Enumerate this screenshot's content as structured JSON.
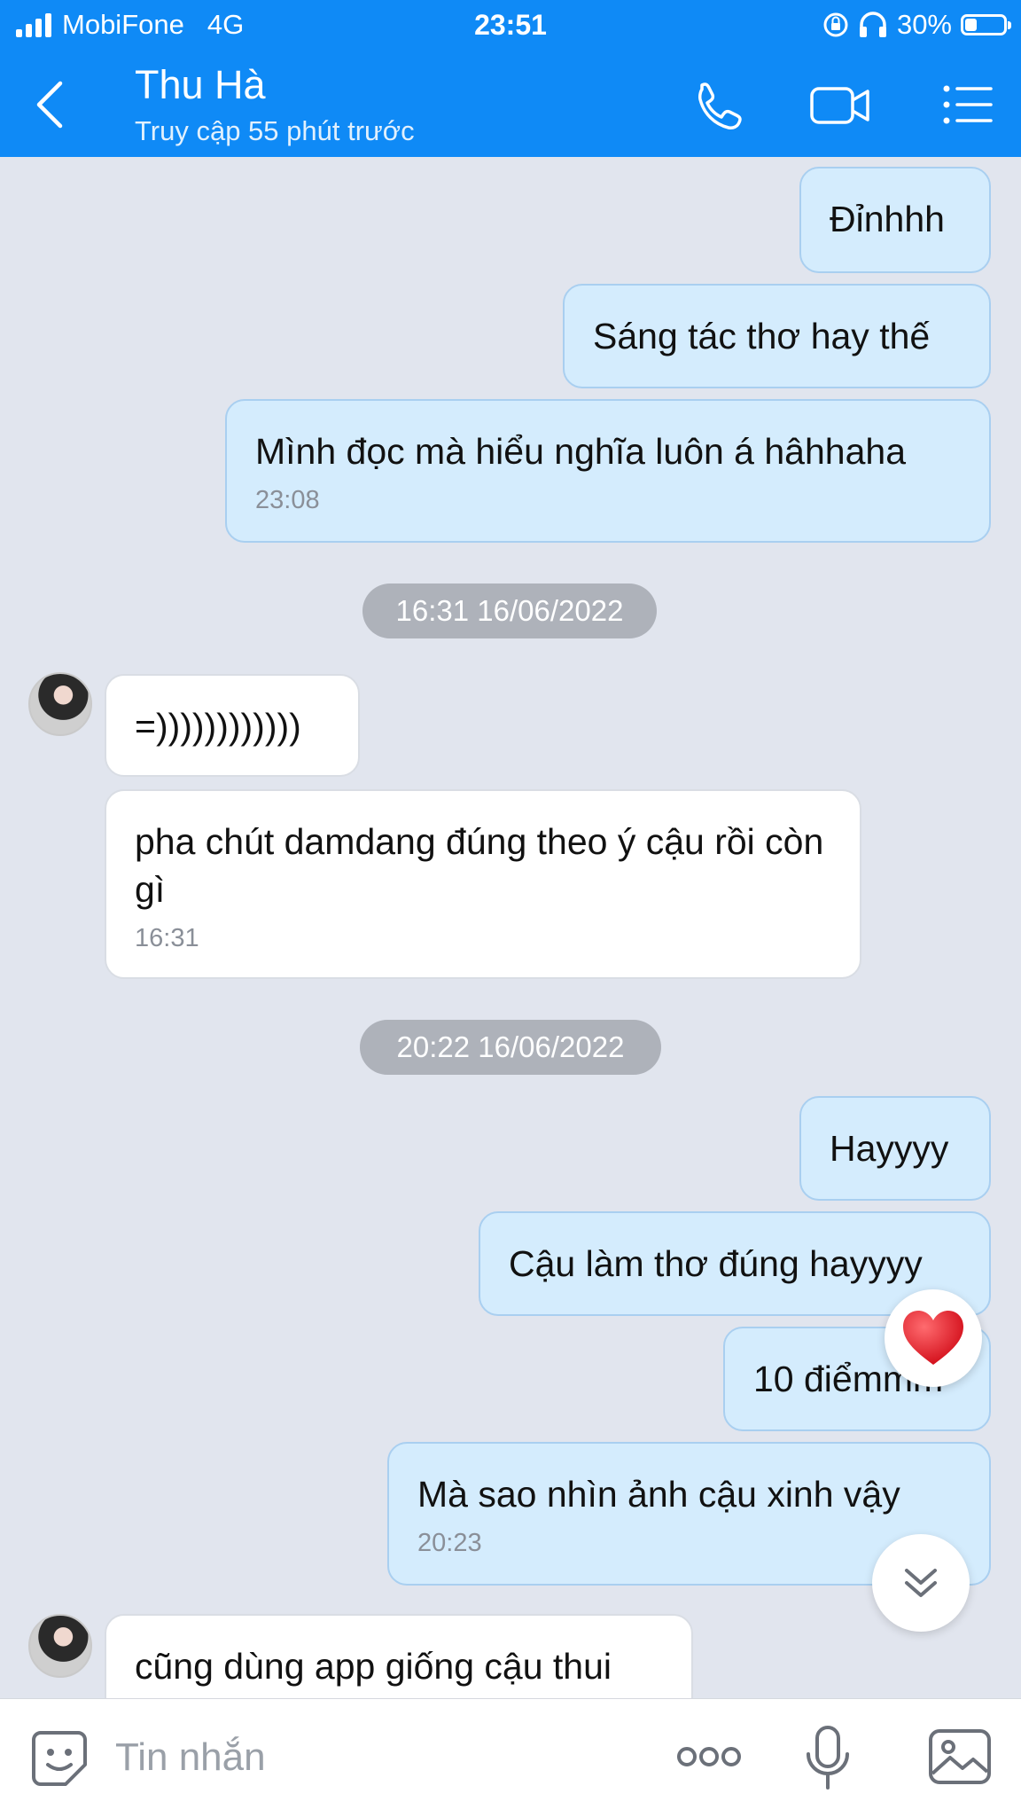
{
  "status_bar": {
    "carrier": "MobiFone",
    "network": "4G",
    "time": "23:51",
    "battery_text": "30%",
    "battery_level": 0.3
  },
  "header": {
    "name": "Thu Hà",
    "status": "Truy cập 55 phút trước",
    "icons": [
      "back-arrow-icon",
      "phone-icon",
      "video-call-icon",
      "menu-list-icon"
    ]
  },
  "messages": [
    {
      "side": "sent",
      "text": "Đỉnhhh"
    },
    {
      "side": "sent",
      "text": "Sáng tác thơ hay thế"
    },
    {
      "side": "sent",
      "text": "Mình đọc mà hiểu nghĩa luôn á hâhhaha",
      "time": "23:08"
    },
    {
      "side": "divider",
      "text": "16:31 16/06/2022"
    },
    {
      "side": "received",
      "text": "=))))))))))))"
    },
    {
      "side": "received",
      "text": "pha chút damdang đúng theo ý cậu rồi còn gì",
      "time": "16:31"
    },
    {
      "side": "divider",
      "text": "20:22 16/06/2022"
    },
    {
      "side": "sent",
      "text": "Hayyyy"
    },
    {
      "side": "sent",
      "text": "Cậu làm thơ đúng hayyyy"
    },
    {
      "side": "sent",
      "text": "10 điểmmm"
    },
    {
      "side": "sent",
      "text": "Mà sao nhìn ảnh cậu xinh vậy",
      "time": "20:23"
    },
    {
      "side": "received",
      "text": "cũng dùng app giống cậu thui"
    }
  ],
  "reaction": {
    "icon": "heart-icon",
    "color": "#e8141f"
  },
  "input": {
    "placeholder": "Tin nhắn",
    "value": "",
    "icons": [
      "sticker-icon",
      "more-dots-icon",
      "microphone-icon",
      "image-icon"
    ]
  },
  "colors": {
    "header": "#0f8af6",
    "sent_bubble": "#d4ecfd",
    "received_bubble": "#ffffff",
    "background": "#e1e5ee"
  }
}
